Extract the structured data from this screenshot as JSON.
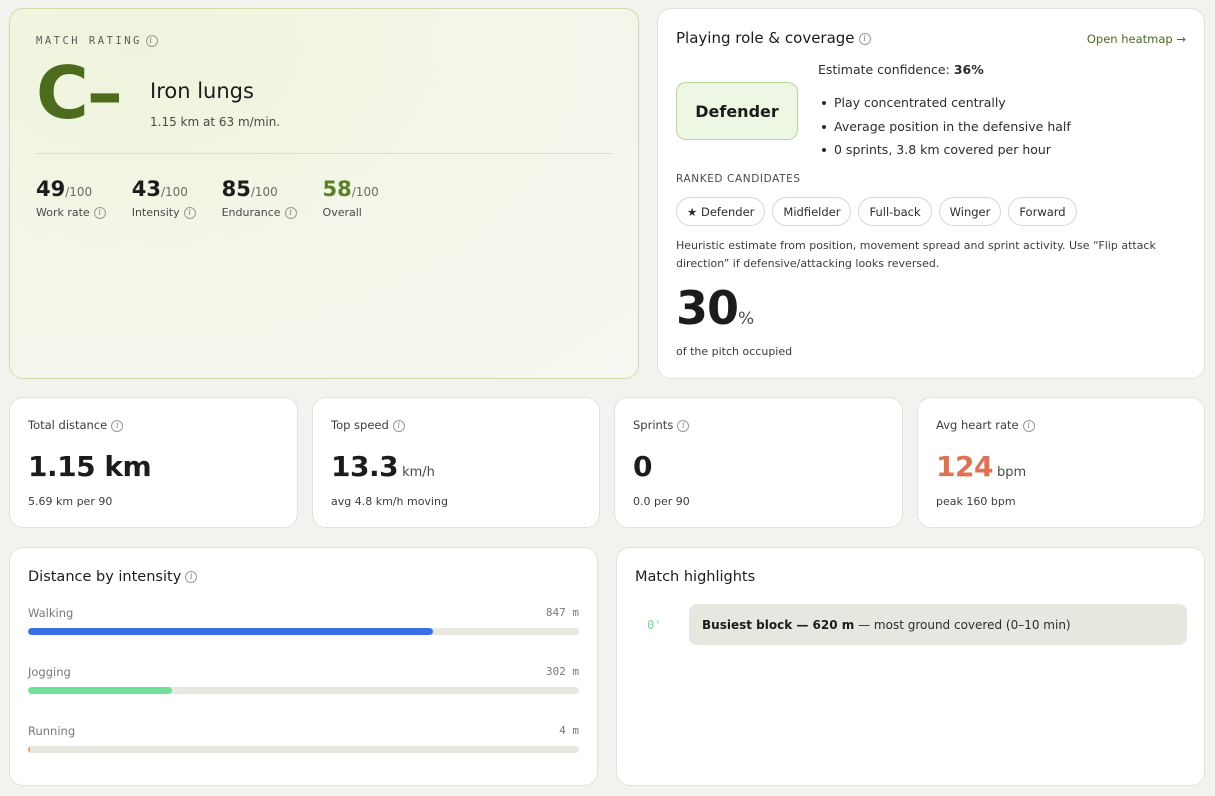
{
  "rating": {
    "label": "MATCH RATING",
    "grade": "C–",
    "title": "Iron lungs",
    "subtitle": "1.15 km at 63 m/min.",
    "scores": [
      {
        "value": "49",
        "denom": "/100",
        "label": "Work rate",
        "info": true
      },
      {
        "value": "43",
        "denom": "/100",
        "label": "Intensity",
        "info": true
      },
      {
        "value": "85",
        "denom": "/100",
        "label": "Endurance",
        "info": true
      },
      {
        "value": "58",
        "denom": "/100",
        "label": "Overall",
        "info": false
      }
    ]
  },
  "role": {
    "title": "Playing role & coverage",
    "heatmap_link": "Open heatmap →",
    "badge": "Defender",
    "confidence_label": "Estimate confidence: ",
    "confidence_value": "36%",
    "bullets": [
      "Play concentrated centrally",
      "Average position in the defensive half",
      "0 sprints, 3.8 km covered per hour"
    ],
    "ranked_label": "RANKED CANDIDATES",
    "candidates": [
      "★ Defender",
      "Midfielder",
      "Full-back",
      "Winger",
      "Forward"
    ],
    "heuristic_text": "Heuristic estimate from position, movement spread and sprint activity. Use “Flip attack direction” if defensive/attacking looks reversed.",
    "pitch_value": "30",
    "pitch_unit": "%",
    "pitch_label": "of the pitch occupied"
  },
  "stats": {
    "distance": {
      "label": "Total distance",
      "value": "1.15 km",
      "unit": "",
      "sub": "5.69 km per 90"
    },
    "speed": {
      "label": "Top speed",
      "value": "13.3",
      "unit": "km/h",
      "sub": "avg 4.8 km/h moving"
    },
    "sprints": {
      "label": "Sprints",
      "value": "0",
      "unit": "",
      "sub": "0.0 per 90"
    },
    "heart_rate": {
      "label": "Avg heart rate",
      "value": "124",
      "unit": "bpm",
      "sub": "peak 160 bpm"
    }
  },
  "intensity": {
    "title": "Distance by intensity",
    "bars": [
      {
        "label": "Walking",
        "value": "847 m",
        "fraction": 0.735,
        "color": "#3a6fe8"
      },
      {
        "label": "Jogging",
        "value": "302 m",
        "fraction": 0.262,
        "color": "#6fe09a"
      },
      {
        "label": "Running",
        "value": "4 m",
        "fraction": 0.004,
        "color": "#f0a060"
      }
    ]
  },
  "highlights": {
    "title": "Match highlights",
    "items": [
      {
        "minute": "0'",
        "bold": "Busiest block — 620 m",
        "text": " — most ground covered (0–10 min)"
      }
    ]
  },
  "icons": {
    "info": "info-icon"
  }
}
